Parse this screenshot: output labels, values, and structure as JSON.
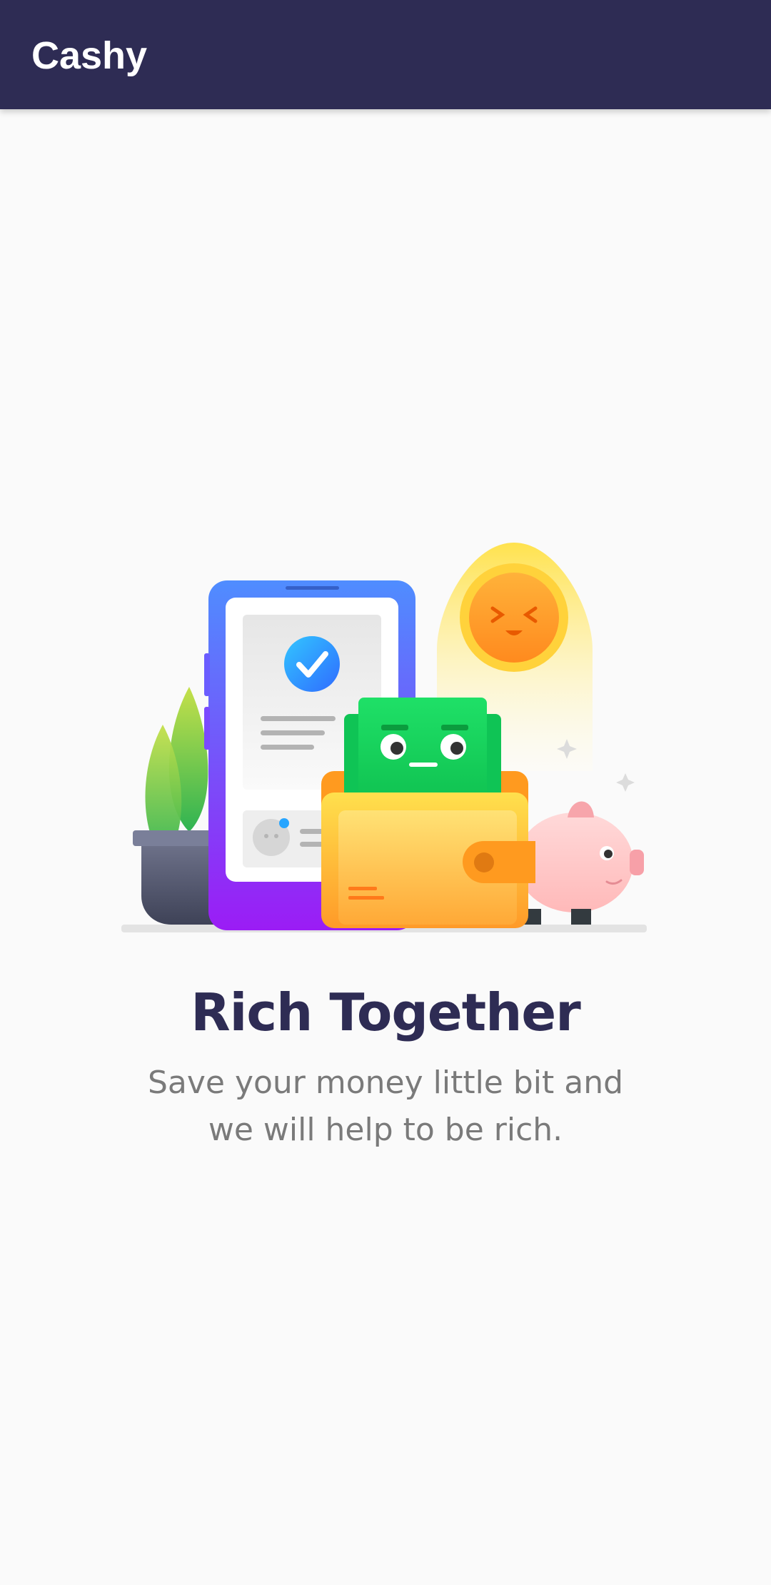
{
  "app_bar": {
    "title": "Cashy",
    "background_color": "#2e2c54"
  },
  "onboarding": {
    "illustration_icon": "wallet-phone-piggybank-illustration",
    "headline": "Rich Together",
    "subtitle": "Save your money little bit and we will help to be rich."
  },
  "colors": {
    "headline": "#2e2c54",
    "subtitle": "#7a7a7a",
    "background": "#fafafa"
  }
}
